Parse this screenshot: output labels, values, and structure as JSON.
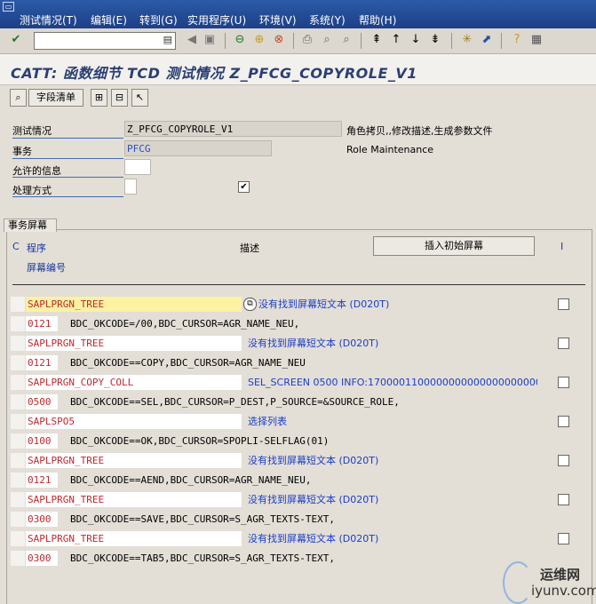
{
  "menubar": {
    "items": [
      "测试情况(T)",
      "编辑(E)",
      "转到(G)",
      "实用程序(U)",
      "环境(V)",
      "系统(Y)",
      "帮助(H)"
    ]
  },
  "toolbar": {
    "command_value": "",
    "icons": [
      "enter-icon",
      "dropdown-icon",
      "back-icon",
      "save-icon",
      "back-green-icon",
      "exit-icon",
      "cancel-icon",
      "print-icon",
      "find-icon",
      "find-next-icon",
      "first-page-icon",
      "prev-page-icon",
      "next-page-icon",
      "last-page-icon",
      "new-session-icon",
      "shortcut-icon",
      "help-icon",
      "layout-icon"
    ]
  },
  "title": "CATT: 函数细节 TCD  测试情况 Z_PFCG_COPYROLE_V1",
  "app_toolbar": {
    "field_list_label": "字段清单"
  },
  "form": {
    "test_case_label": "测试情况",
    "test_case_value": "Z_PFCG_COPYROLE_V1",
    "test_case_desc": "角色拷贝,,修改描述,生成参数文件",
    "transaction_label": "事务",
    "transaction_value": "PFCG",
    "transaction_desc": "Role Maintenance",
    "allowed_msg_label": "允许的信息",
    "processing_label": "处理方式",
    "processing_checked": "✔"
  },
  "group": {
    "title": "事务屏幕",
    "col_c": "C",
    "col_program": "程序",
    "col_screen_no": "屏幕编号",
    "col_desc": "描述",
    "insert_button": "插入初始屏幕",
    "col_i": "I"
  },
  "rows": [
    {
      "program": "SAPLPRGN_TREE",
      "desc": "没有找到屏幕短文本 (D020T)",
      "screen": "0121",
      "fields": "BDC_OKCODE=/00,BDC_CURSOR=AGR_NAME_NEU,"
    },
    {
      "program": "SAPLPRGN_TREE",
      "desc": "没有找到屏幕短文本 (D020T)",
      "screen": "0121",
      "fields": "BDC_OKCODE==COPY,BDC_CURSOR=AGR_NAME_NEU"
    },
    {
      "program": "SAPLPRGN_COPY_COLL",
      "desc": "SEL_SCREEN 0500 INFO:17000011000000000000000000000",
      "screen": "0500",
      "fields": "BDC_OKCODE==SEL,BDC_CURSOR=P_DEST,P_SOURCE=&SOURCE_ROLE,"
    },
    {
      "program": "SAPLSPO5",
      "desc": "选择列表",
      "screen": "0100",
      "fields": "BDC_OKCODE==OK,BDC_CURSOR=SPOPLI-SELFLAG(01)"
    },
    {
      "program": "SAPLPRGN_TREE",
      "desc": "没有找到屏幕短文本 (D020T)",
      "screen": "0121",
      "fields": "BDC_OKCODE==AEND,BDC_CURSOR=AGR_NAME_NEU,"
    },
    {
      "program": "SAPLPRGN_TREE",
      "desc": "没有找到屏幕短文本 (D020T)",
      "screen": "0300",
      "fields": "BDC_OKCODE==SAVE,BDC_CURSOR=S_AGR_TEXTS-TEXT,"
    },
    {
      "program": "SAPLPRGN_TREE",
      "desc": "没有找到屏幕短文本 (D020T)",
      "screen": "0300",
      "fields": "BDC_OKCODE==TAB5,BDC_CURSOR=S_AGR_TEXTS-TEXT,"
    }
  ],
  "watermark": {
    "line1": "运维网",
    "line2": "iyunv.com"
  }
}
